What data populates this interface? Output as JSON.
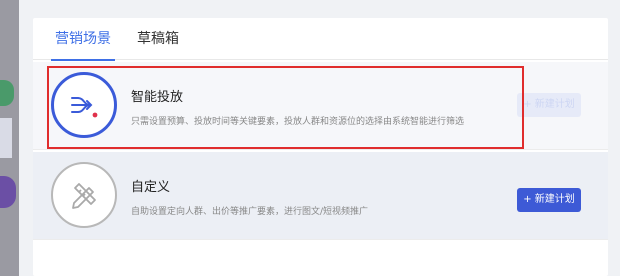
{
  "tabs": [
    {
      "label": "营销场景",
      "active": true
    },
    {
      "label": "草稿箱",
      "active": false
    }
  ],
  "items": [
    {
      "title": "智能投放",
      "description": "只需设置预算、投放时间等关键要素，投放人群和资源位的选择由系统智能进行筛选",
      "button": "+ 新建计划",
      "icon": "smart-flow-icon",
      "selected": true
    },
    {
      "title": "自定义",
      "description": "自助设置定向人群、出价等推广要素，进行图文/短视频推广",
      "button": "+ 新建计划",
      "icon": "pencil-ruler-icon",
      "selected": false
    }
  ],
  "colors": {
    "accent": "#3e6fe6",
    "button": "#3d5ad6",
    "highlight": "#e02d2d"
  }
}
